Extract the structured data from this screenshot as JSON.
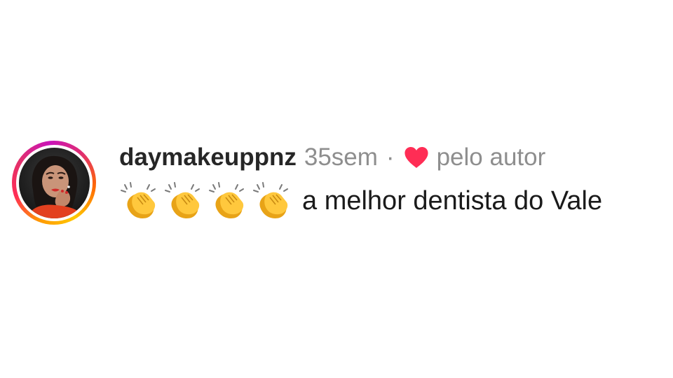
{
  "comment": {
    "username": "daymakeuppnz",
    "time": "35sem",
    "separator": "·",
    "liked_by_author": "pelo autor",
    "emojis": [
      "clap-emoji",
      "clap-emoji",
      "clap-emoji",
      "clap-emoji"
    ],
    "text": "a melhor dentista do Vale"
  },
  "colors": {
    "heart": "#ff2d55",
    "username": "#262626",
    "muted": "#8e8e8e",
    "text": "#1a1a1a"
  },
  "icons": {
    "heart": "heart-icon",
    "avatar": "avatar"
  }
}
